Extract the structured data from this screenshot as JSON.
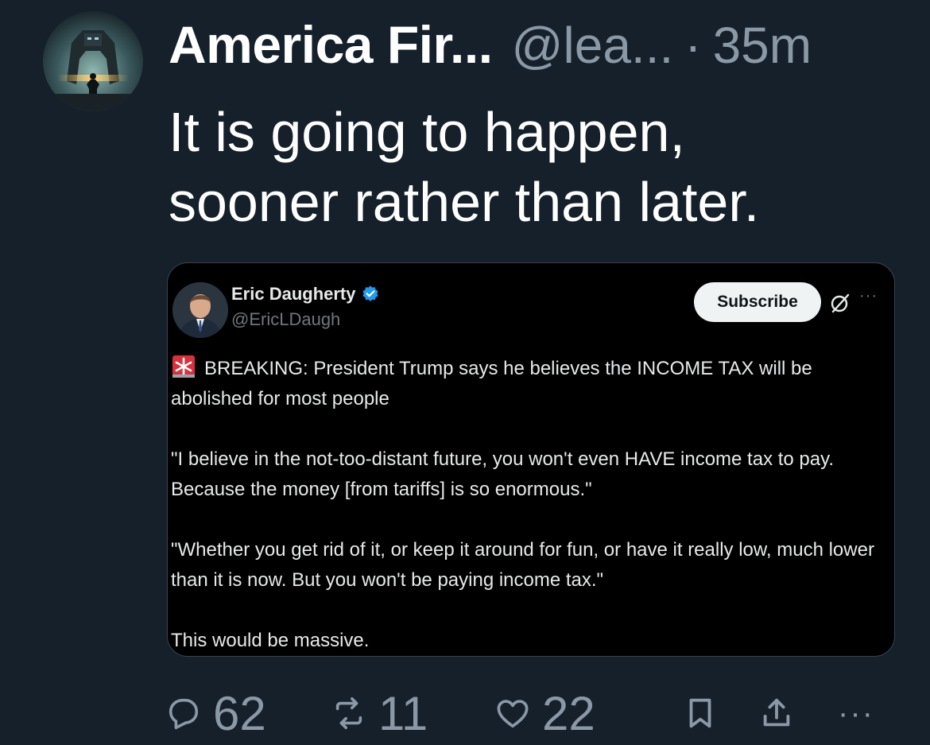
{
  "post": {
    "display_name": "America Fir...",
    "handle": "@lea...",
    "separator": "·",
    "time": "35m",
    "text_lines": [
      "It is going to happen,",
      "sooner rather than later."
    ]
  },
  "embedded": {
    "name": "Eric Daugherty",
    "handle": "@EricLDaugh",
    "subscribe_label": "Subscribe",
    "more": "···",
    "paragraphs": [
      "BREAKING: President Trump says he believes the INCOME TAX will be abolished for most people",
      "\"I believe in the not-too-distant future, you won't even HAVE income tax to pay. Because the money [from tariffs] is so enormous.\"",
      "\"Whether you get rid of it, or keep it around for fun, or have it really low, much lower than it is now. But you won't be paying income tax.\"",
      "This would be massive."
    ]
  },
  "actions": {
    "replies": "62",
    "reposts": "11",
    "likes": "22",
    "more": "···"
  },
  "icons": {
    "reply": "reply-icon",
    "repost": "repost-icon",
    "like": "heart-icon",
    "bookmark": "bookmark-icon",
    "share": "share-icon",
    "more": "more-icon",
    "verified": "verified-badge-icon",
    "siren": "siren-emoji-icon",
    "grok": "grok-icon"
  },
  "colors": {
    "background": "#15202b",
    "muted_text": "#8b98a5",
    "verified_blue": "#1d9bf0",
    "siren_red": "#e0245e"
  }
}
